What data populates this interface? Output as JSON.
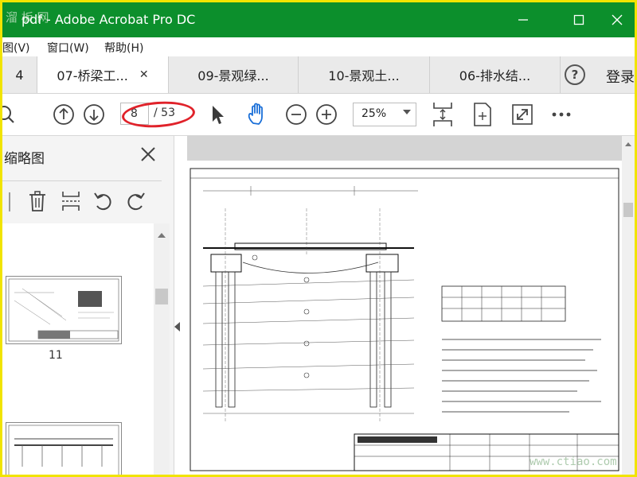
{
  "window": {
    "watermark": "溜 板 网",
    "title": "pdf - Adobe Acrobat Pro DC"
  },
  "menu": {
    "items": [
      "图(V)",
      "窗口(W)",
      "帮助(H)"
    ]
  },
  "tabs": [
    {
      "label": "4",
      "active": false
    },
    {
      "label": "07-桥梁工...",
      "active": true
    },
    {
      "label": "09-景观绿...",
      "active": false
    },
    {
      "label": "10-景观土...",
      "active": false
    },
    {
      "label": "06-排水结...",
      "active": false
    }
  ],
  "header": {
    "help_icon": "?",
    "login_label": "登录"
  },
  "toolbar": {
    "current_page": "8",
    "total_pages": "/ 53",
    "zoom": "25%"
  },
  "panel": {
    "title": "缩略图",
    "thumbnails": [
      {
        "label": "11"
      }
    ]
  },
  "footer": {
    "watermark": "www.ctiao.com"
  },
  "colors": {
    "titlebar": "#0c8f2c",
    "highlight_ellipse": "#e0222a",
    "frame_border": "#f1e400",
    "hand_tool": "#1a6fd8"
  }
}
